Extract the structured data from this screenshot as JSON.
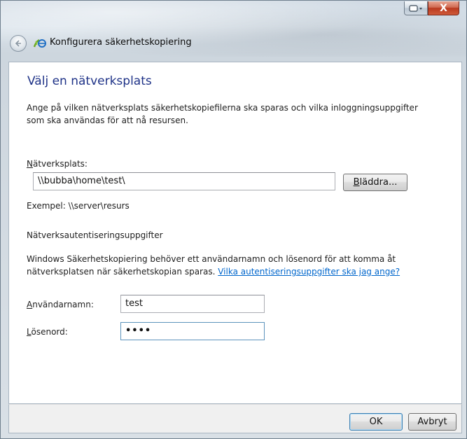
{
  "window": {
    "title": "Konfigurera säkerhetskopiering",
    "close_glyph": "X"
  },
  "page": {
    "heading": "Välj en nätverksplats",
    "intro_line1": "Ange på vilken nätverksplats säkerhetskopiefilerna ska sparas och vilka inloggningsuppgifter",
    "intro_line2": "som ska användas för att nå resursen."
  },
  "location": {
    "label_accel": "N",
    "label_rest": "ätverksplats:",
    "value": "\\\\bubba\\home\\test\\",
    "browse_accel": "B",
    "browse_rest": "läddra...",
    "example": "Exempel: \\\\server\\resurs"
  },
  "credentials": {
    "section_title": "Nätverksautentiseringsuppgifter",
    "desc_line1": "Windows Säkerhetskopiering behöver ett användarnamn och lösenord för att komma åt",
    "desc_line2": "nätverksplatsen när säkerhetskopian sparas.",
    "help_link": "Vilka autentiseringsuppgifter ska jag ange?",
    "username_accel": "A",
    "username_rest": "nvändarnamn:",
    "username_value": "test",
    "password_accel": "L",
    "password_rest": "ösenord:",
    "password_value": "••••"
  },
  "footer": {
    "ok_label": "OK",
    "cancel_label": "Avbryt"
  }
}
